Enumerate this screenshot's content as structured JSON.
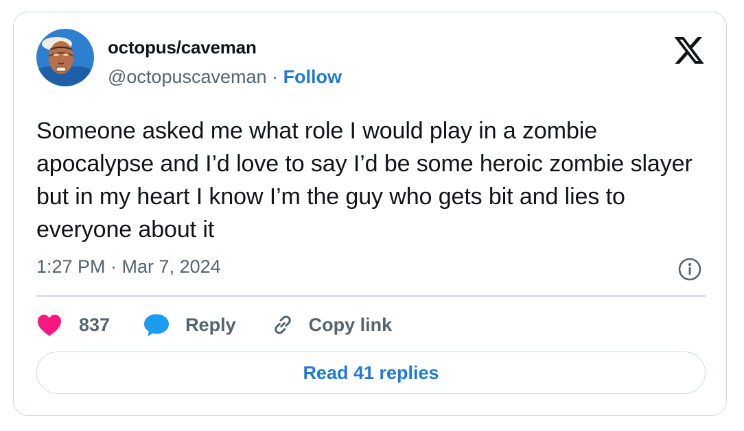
{
  "author": {
    "name": "octopus/caveman",
    "handle": "@octopuscaveman",
    "separator": "·",
    "follow_label": "Follow"
  },
  "tweet": {
    "text": "Someone asked me what role I would play in a zombie apocalypse and I’d love to say I’d be some heroic zombie slayer but in my heart I know I’m the guy who gets bit and lies to everyone about it",
    "timestamp": "1:27 PM · Mar 7, 2024"
  },
  "actions": {
    "like_count": "837",
    "reply_label": "Reply",
    "copy_label": "Copy link"
  },
  "read_replies_label": "Read 41 replies",
  "icons": {
    "x": "x-logo-icon",
    "info": "info-icon",
    "heart": "heart-icon",
    "reply": "speech-bubble-icon",
    "link": "link-icon"
  },
  "colors": {
    "heart": "#f91880",
    "reply": "#1d9bf0",
    "follow_link": "#1d7bd8",
    "secondary_text": "#536471",
    "border": "#cfd9de"
  }
}
